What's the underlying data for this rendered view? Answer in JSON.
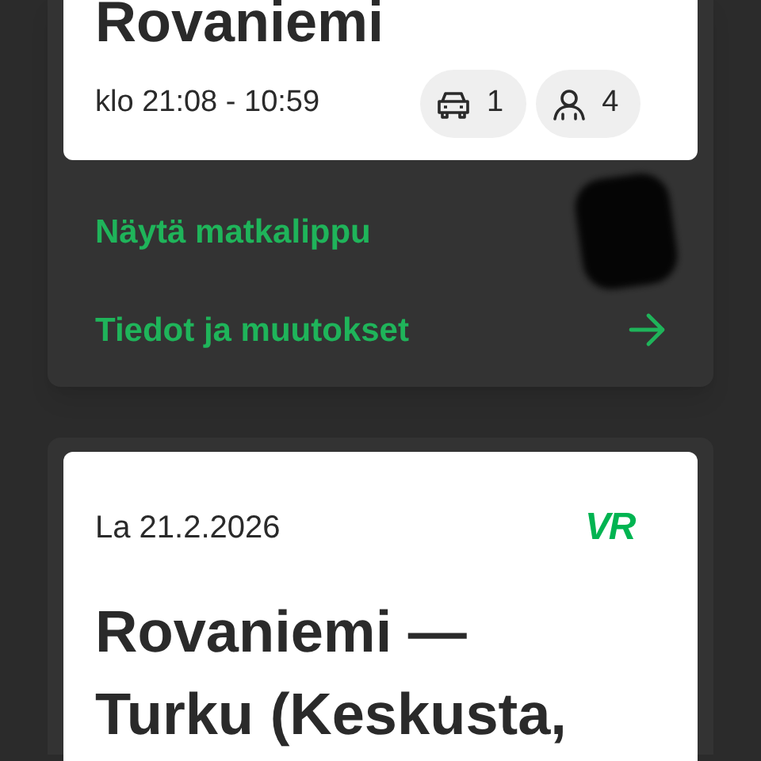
{
  "trips": [
    {
      "title": "Rovaniemi",
      "time": "klo 21:08 - 10:59",
      "counts": [
        {
          "kind": "car",
          "value": "1"
        },
        {
          "kind": "passenger",
          "value": "4"
        }
      ],
      "redacted": true,
      "links": [
        {
          "label": "Näytä matkalippu",
          "arrow": false
        },
        {
          "label": "Tiedot ja muutokset",
          "arrow": true
        }
      ]
    },
    {
      "date": "La 21.2.2026",
      "logo": "VR",
      "title": "Rovaniemi — Turku (Keskusta,"
    }
  ]
}
